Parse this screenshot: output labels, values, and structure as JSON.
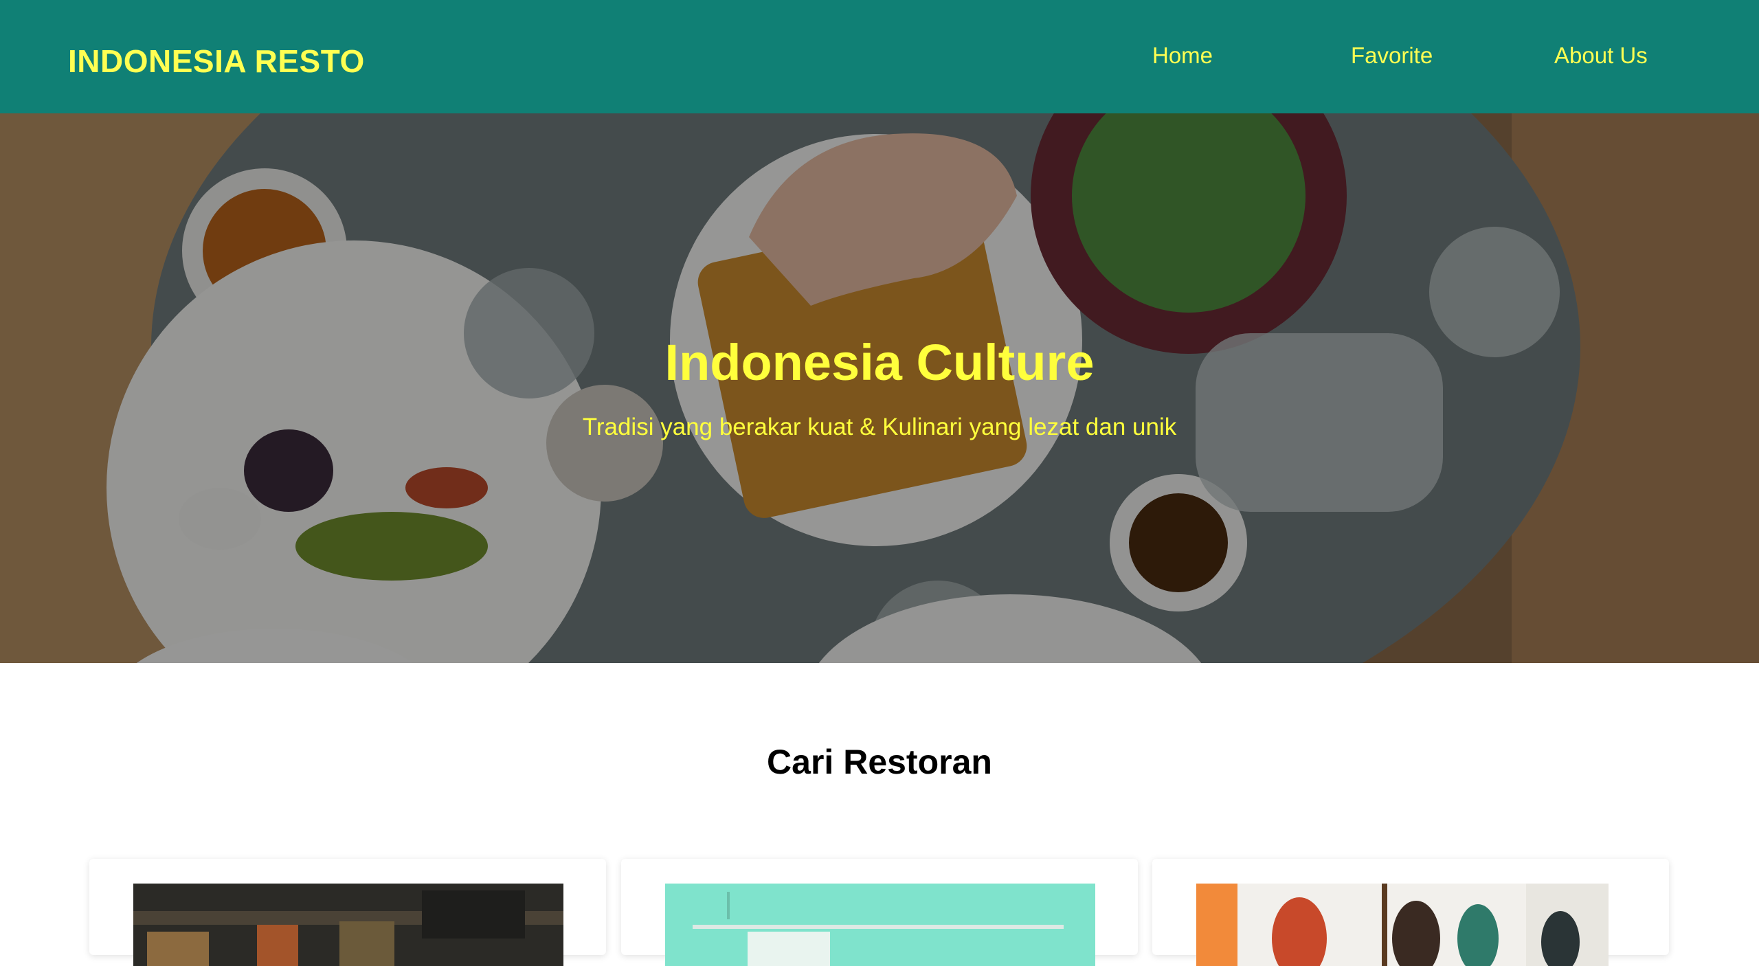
{
  "header": {
    "brand": "INDONESIA RESTO",
    "nav": [
      "Home",
      "Favorite",
      "About Us"
    ]
  },
  "hero": {
    "title": "Indonesia Culture",
    "subtitle": "Tradisi yang berakar kuat & Kulinari yang lezat dan unik"
  },
  "search": {
    "title": "Cari Restoran"
  },
  "colors": {
    "header_bg": "#108075",
    "accent_yellow": "#ffff52"
  }
}
